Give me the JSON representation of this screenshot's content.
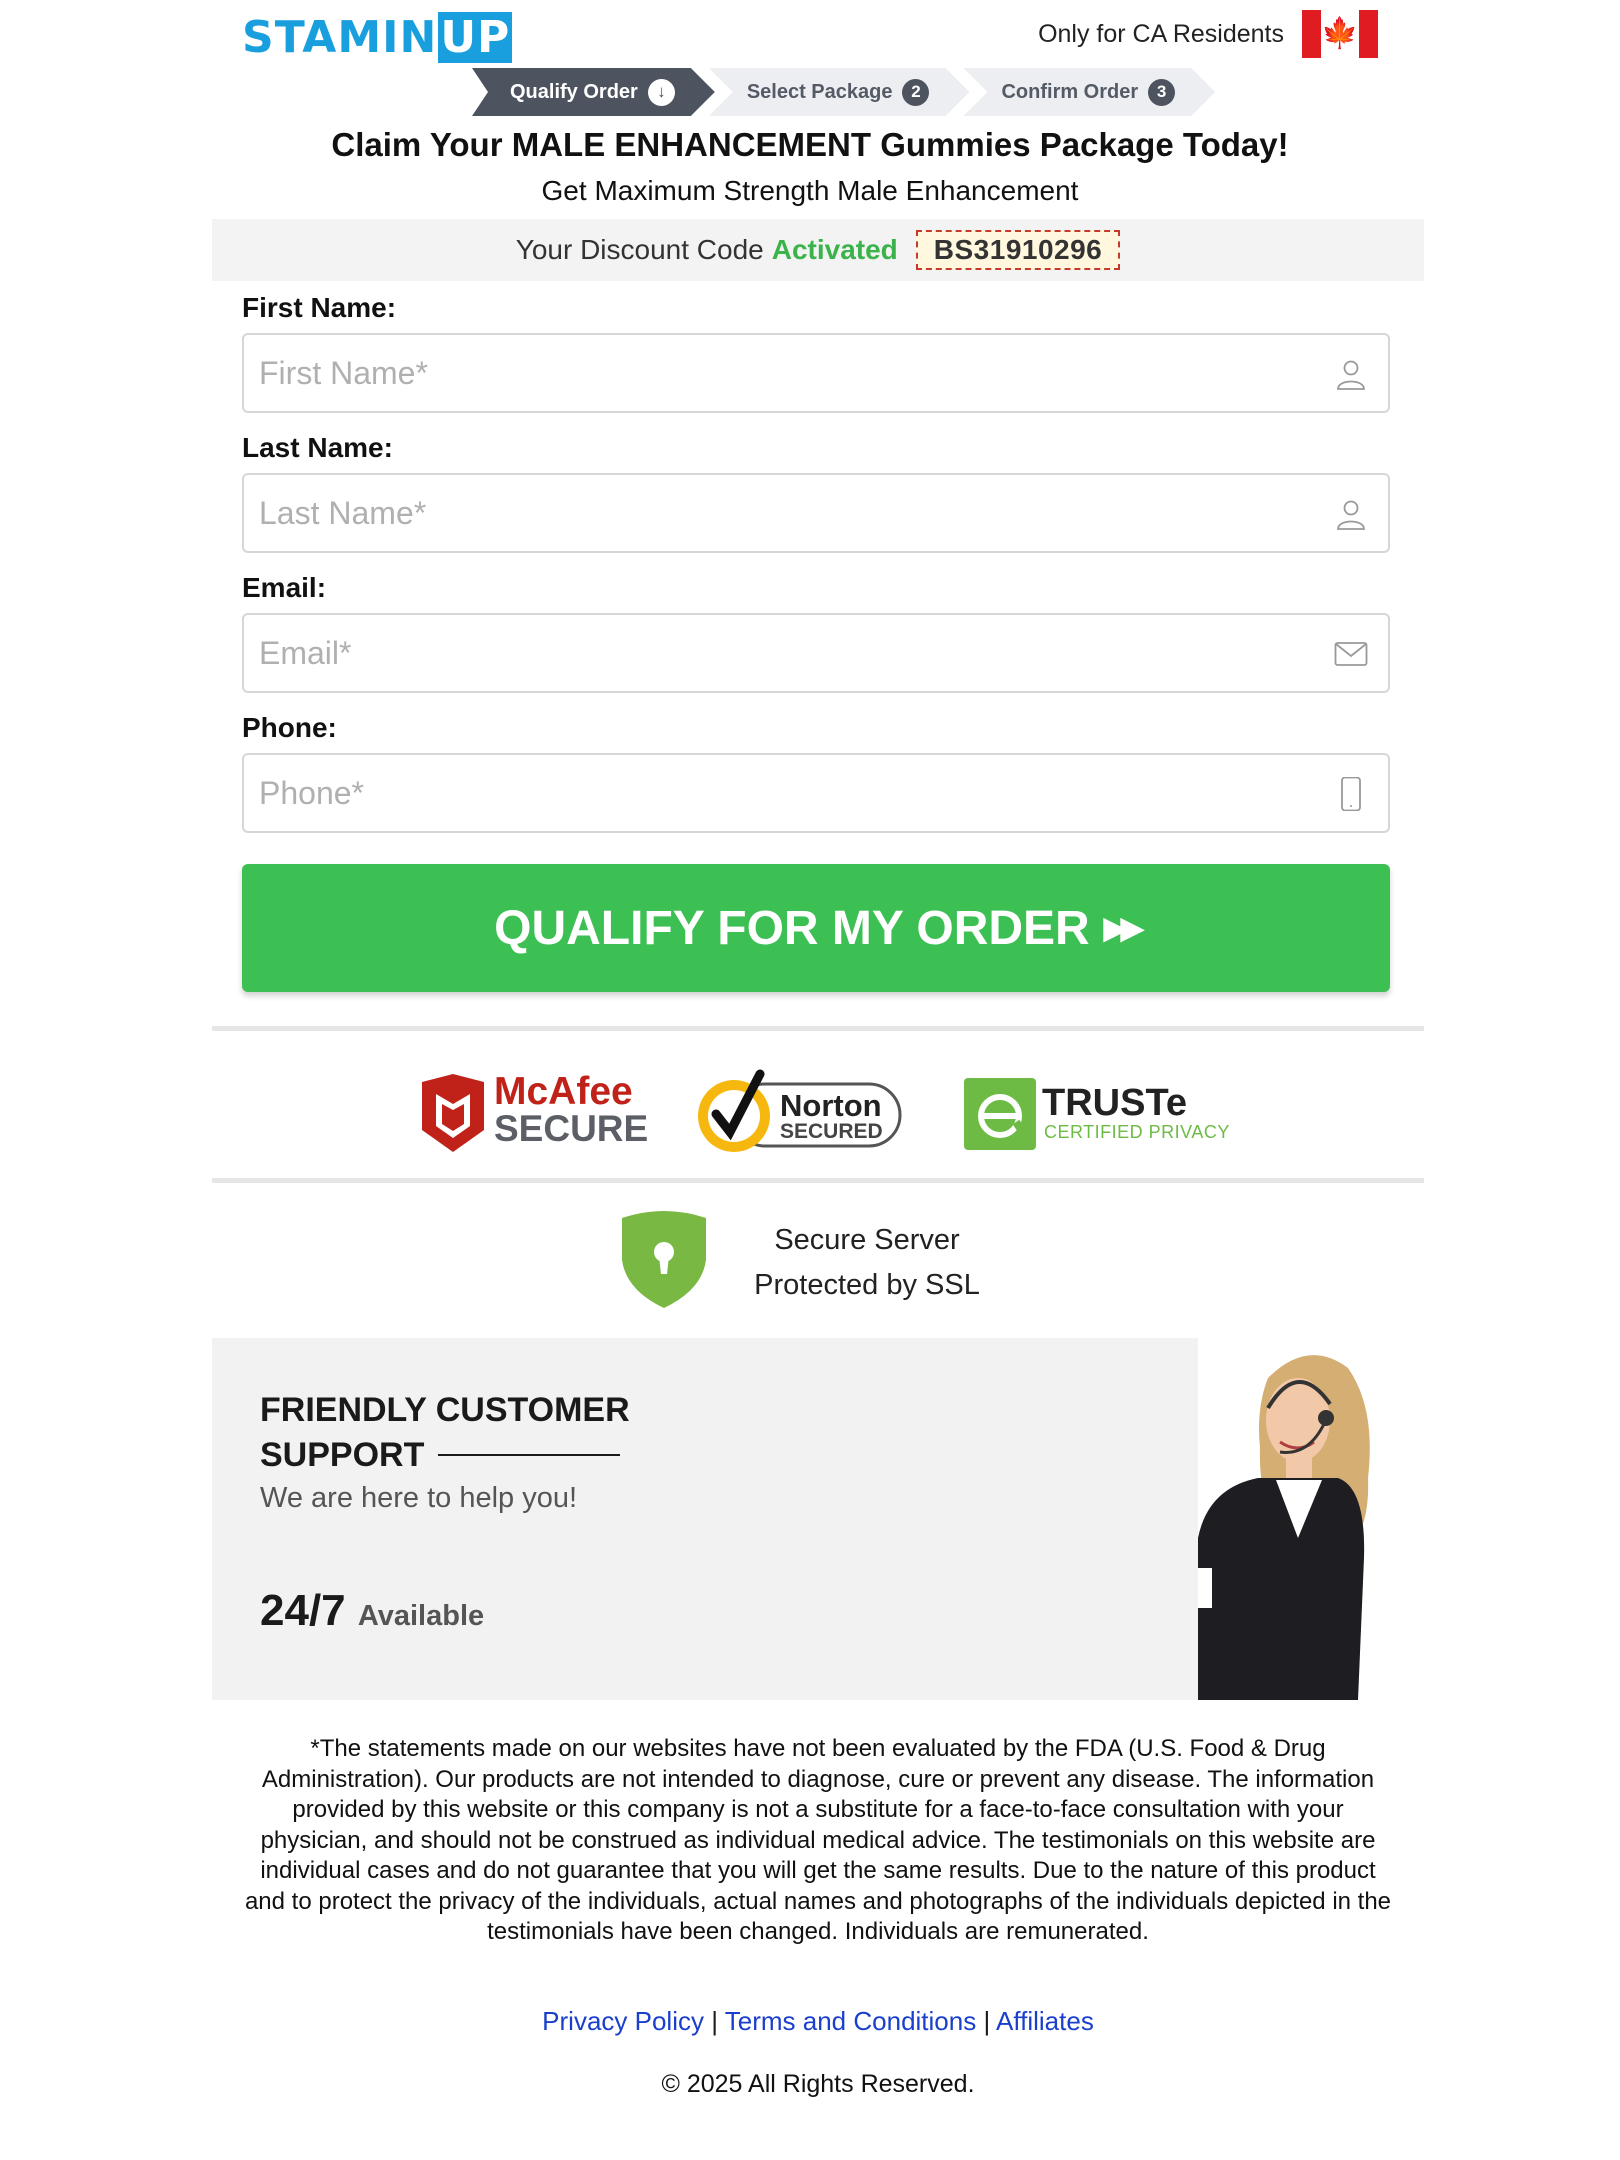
{
  "header": {
    "logo": "STAMIN",
    "logo_suffix": "UP",
    "residents": "Only for CA Residents",
    "flag_icon": "canada-flag-icon"
  },
  "steps": [
    {
      "label": "Qualify Order",
      "badge": "↓"
    },
    {
      "label": "Select Package",
      "badge": "2"
    },
    {
      "label": "Confirm Order",
      "badge": "3"
    }
  ],
  "headline": "Claim Your MALE ENHANCEMENT Gummies Package Today!",
  "subhead": "Get Maximum Strength Male Enhancement",
  "discount": {
    "prefix": "Your Discount Code",
    "status": "Activated",
    "code": "BS31910296"
  },
  "form": {
    "first_name": {
      "label": "First Name:",
      "placeholder": "First Name*"
    },
    "last_name": {
      "label": "Last Name:",
      "placeholder": "Last Name*"
    },
    "email": {
      "label": "Email:",
      "placeholder": "Email*"
    },
    "phone": {
      "label": "Phone:",
      "placeholder": "Phone*"
    },
    "submit": "QUALIFY FOR MY ORDER",
    "submit_arrows": "▶▶"
  },
  "trust": {
    "mcafee_top": "McAfee",
    "mcafee_bottom": "SECURE",
    "norton_top": "Norton",
    "norton_bottom": "SECURED",
    "truste_top": "TRUSTe",
    "truste_bottom": "CERTIFIED PRIVACY"
  },
  "secure": {
    "line1": "Secure Server",
    "line2": "Protected by SSL"
  },
  "support": {
    "title_line1": "FRIENDLY CUSTOMER",
    "title_line2": "SUPPORT",
    "help": "We are here to help you!",
    "hours": "24/7",
    "available": "Available"
  },
  "disclaimer": "*The statements made on our websites have not been evaluated by the FDA (U.S. Food & Drug Administration). Our products are not intended to diagnose, cure or prevent any disease. The information provided by this website or this company is not a substitute for a face-to-face consultation with your physician, and should not be construed as individual medical advice. The testimonials on this website are individual cases and do not guarantee that you will get the same results. Due to the nature of this product and to protect the privacy of the individuals, actual names and photographs of the individuals depicted in the testimonials have been changed. Individuals are remunerated.",
  "footer": {
    "privacy": "Privacy Policy",
    "sep": "|",
    "terms": "Terms and Conditions",
    "affiliates": "Affiliates",
    "copyright": "© 2025 All Rights Reserved."
  },
  "colors": {
    "brand": "#1a9fde",
    "cta": "#3cc054",
    "activated": "#3bb34a",
    "step_active": "#4e5360",
    "link": "#1a3fcc"
  }
}
